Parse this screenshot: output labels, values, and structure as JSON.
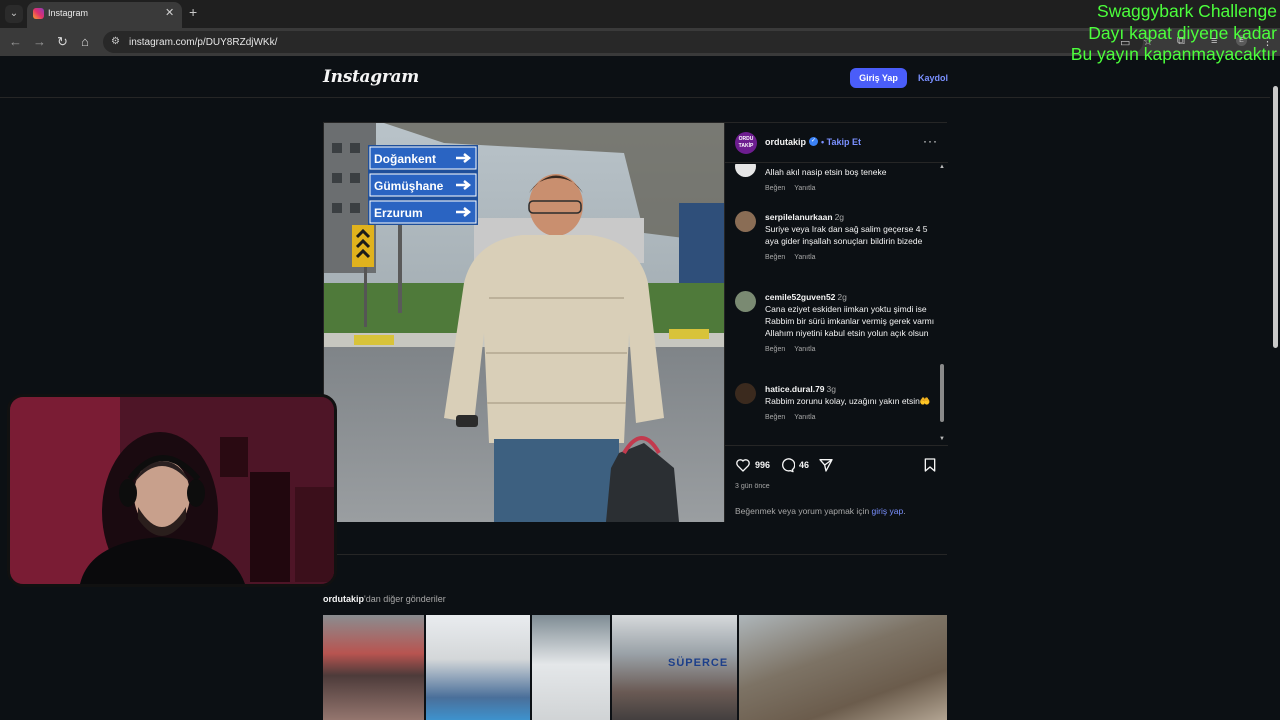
{
  "browser": {
    "tab_title": "Instagram",
    "tab_close": "✕",
    "new_tab": "+",
    "tab_list": "⌄",
    "url": "instagram.com/p/DUY8RZdjWKk/",
    "back": "←",
    "forward": "→",
    "reload": "↻",
    "home": "⌂"
  },
  "header": {
    "logo": "Instagram",
    "login_button": "Giriş Yap",
    "signup_link": "Kaydol"
  },
  "post": {
    "account": "ordutakip",
    "avatar_text": "ORDU TAKİP",
    "follow": "• Takip Et",
    "more": "···",
    "photo_signs": [
      "Doğankent",
      "Gümüşhane",
      "Erzurum"
    ],
    "comments": [
      {
        "user": "",
        "time": "",
        "text": "Allah akıl nasip etsin boş teneke",
        "like": "Beğen",
        "reply": "Yanıtla"
      },
      {
        "user": "serpilelanurkaan",
        "time": "2g",
        "text": "Suriye veya Irak dan sağ salim geçerse 4 5 aya gider inşallah sonuçları bildirin bizede",
        "like": "Beğen",
        "reply": "Yanıtla"
      },
      {
        "user": "cemile52guven52",
        "time": "2g",
        "text": "Cana eziyet eskiden iimkan yoktu şimdi ise Rabbim bir sürü imkanlar vermiş gerek varmı Allahım niyetini kabul etsin yolun açık olsun",
        "like": "Beğen",
        "reply": "Yanıtla"
      },
      {
        "user": "hatice.dural.79",
        "time": "3g",
        "text": "Rabbim zorunu kolay, uzağını yakın etsin🤲",
        "like": "Beğen",
        "reply": "Yanıtla"
      }
    ],
    "likes": "996",
    "comment_count": "46",
    "time_ago": "3 gün önce",
    "login_prompt_prefix": "Beğenmek veya yorum yapmak için ",
    "login_prompt_link": "giriş yap",
    "login_prompt_suffix": "."
  },
  "more_posts": {
    "account": "ordutakip",
    "suffix": "'dan diğer gönderiler",
    "thumb_text": "SÜPERCE"
  },
  "overlay": {
    "lines": [
      "Swaggybark Challenge",
      "Dayı kapat diyene kadar",
      "Bu yayın kapanmayacaktır"
    ]
  },
  "colors": {
    "page_bg": "#0c1014",
    "accent": "#4a5df9",
    "link": "#7a90ff",
    "overlay_text": "#4cff3c"
  }
}
